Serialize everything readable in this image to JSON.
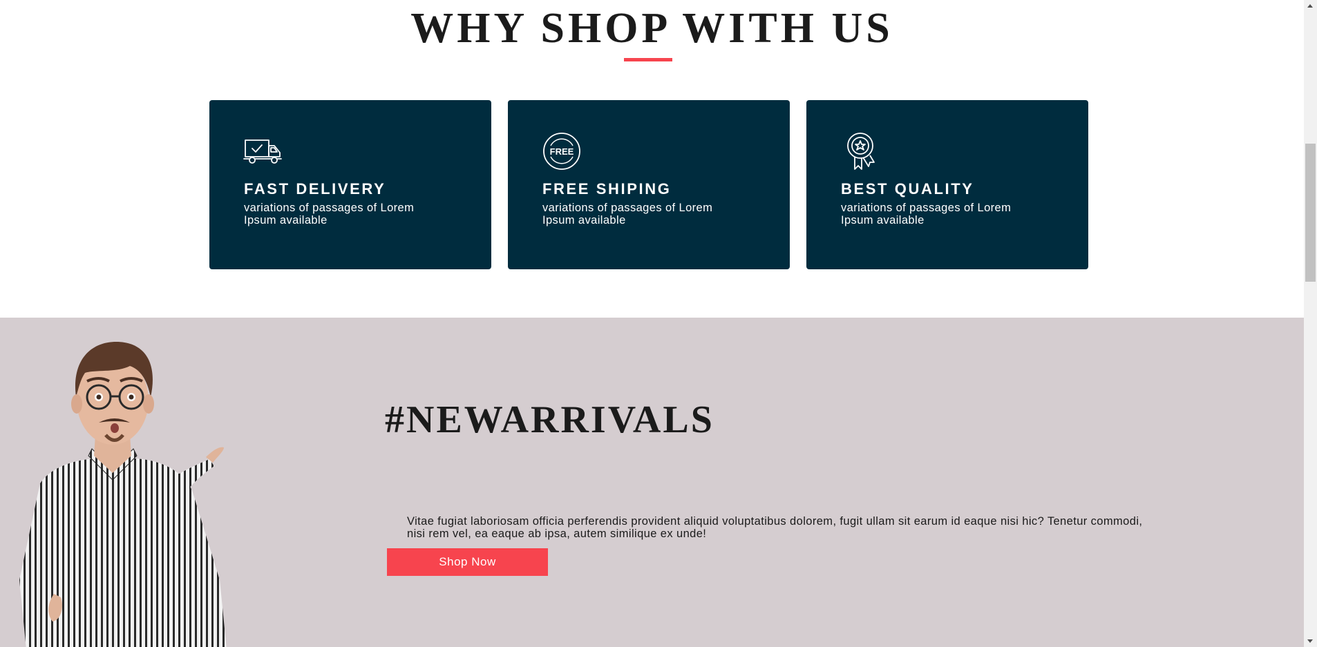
{
  "why_section": {
    "title": "WHY SHOP WITH US",
    "accent_color": "#f7444e",
    "card_color": "#002c3e",
    "cards": [
      {
        "icon": "delivery-truck-icon",
        "title": "FAST DELIVERY",
        "text": "variations of passages of Lorem Ipsum available"
      },
      {
        "icon": "free-badge-icon",
        "title": "FREE SHIPING",
        "text": "variations of passages of Lorem Ipsum available"
      },
      {
        "icon": "award-ribbon-icon",
        "title": "BEST QUALITY",
        "text": "variations of passages of Lorem Ipsum available"
      }
    ]
  },
  "arrivals": {
    "background": "#d5cdd0",
    "title": "#NEWARRIVALS",
    "text": "Vitae fugiat laboriosam officia perferendis provident aliquid voluptatibus dolorem, fugit ullam sit earum id eaque nisi hic? Tenetur commodi, nisi rem vel, ea eaque ab ipsa, autem similique ex unde!",
    "button_label": "Shop Now",
    "button_color": "#f7444e"
  }
}
